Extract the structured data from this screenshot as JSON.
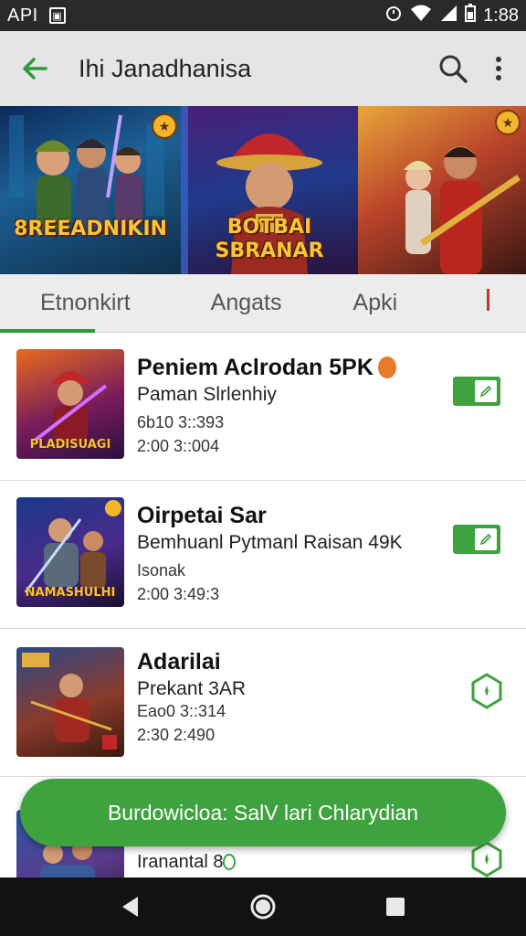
{
  "status_bar": {
    "left_text": "API",
    "right_time": "1:88",
    "icons": [
      "notification-box-icon",
      "alarm-icon",
      "wifi-icon",
      "signal-icon",
      "battery-icon"
    ]
  },
  "app_bar": {
    "title": "Ihi Janadhanisa",
    "icons": [
      "back-arrow-icon",
      "search-icon",
      "more-vert-icon"
    ]
  },
  "banner": {
    "panels": [
      {
        "text": "8REEADNIKIN"
      },
      {
        "text_line1": "BOTBAI",
        "text_line2": "SBRANAR"
      },
      {
        "text": ""
      }
    ]
  },
  "tabs": {
    "items": [
      {
        "label": "Etnonkirt"
      },
      {
        "label": "Angats"
      },
      {
        "label": "Apki"
      }
    ],
    "selected_index": 0
  },
  "list": {
    "items": [
      {
        "title": "Peniem Aclrodan 5PK",
        "subtitle": "Paman Slrlenhiy",
        "meta1": "6b10 3::393",
        "meta2": "2:00 3::004",
        "thumb_label": "PLADISUAGI",
        "control": "toggle-on"
      },
      {
        "title": "Oirpetai Sar",
        "subtitle": "Bemhuanl Pytmanl Raisan 49K",
        "meta1": "Isonak",
        "meta2": "2:00 3:49:3",
        "thumb_label": "NAMASHULHI",
        "control": "toggle-on"
      },
      {
        "title": "Adarilai",
        "subtitle": "Prekant 3AR",
        "meta1": "Eao0 3::314",
        "meta2": "2:30 2:490",
        "thumb_label": "",
        "control": "shield"
      },
      {
        "title": "",
        "subtitle": "Iranantal 8",
        "meta1": "",
        "meta2": "",
        "thumb_label": "",
        "control": "shield"
      }
    ]
  },
  "snackbar": {
    "label": "Burdowicloa: SalV lari Chlarydian"
  },
  "nav_bar": {
    "icons": [
      "back-triangle-icon",
      "home-circle-icon",
      "recents-square-icon"
    ]
  },
  "colors": {
    "accent": "#3ea23e",
    "app_bar_bg": "#e4e5e4",
    "status_bar_bg": "#2a2a2a",
    "nav_bar_bg": "#121212"
  }
}
